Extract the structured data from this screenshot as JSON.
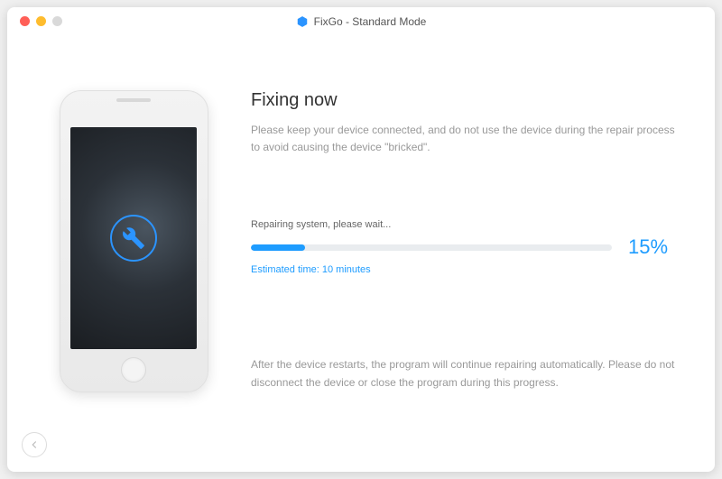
{
  "window": {
    "title": "FixGo - Standard Mode"
  },
  "main": {
    "heading": "Fixing now",
    "description": "Please keep your device connected, and do not use the device during the repair process to avoid causing the device \"bricked\".",
    "status_label": "Repairing system, please wait...",
    "progress_percent_text": "15%",
    "progress_percent": 15,
    "eta": "Estimated time: 10 minutes",
    "footer_note": "After the device restarts, the program will continue repairing automatically. Please do not disconnect the device or close the program during this progress."
  },
  "colors": {
    "accent": "#1e9cff"
  }
}
